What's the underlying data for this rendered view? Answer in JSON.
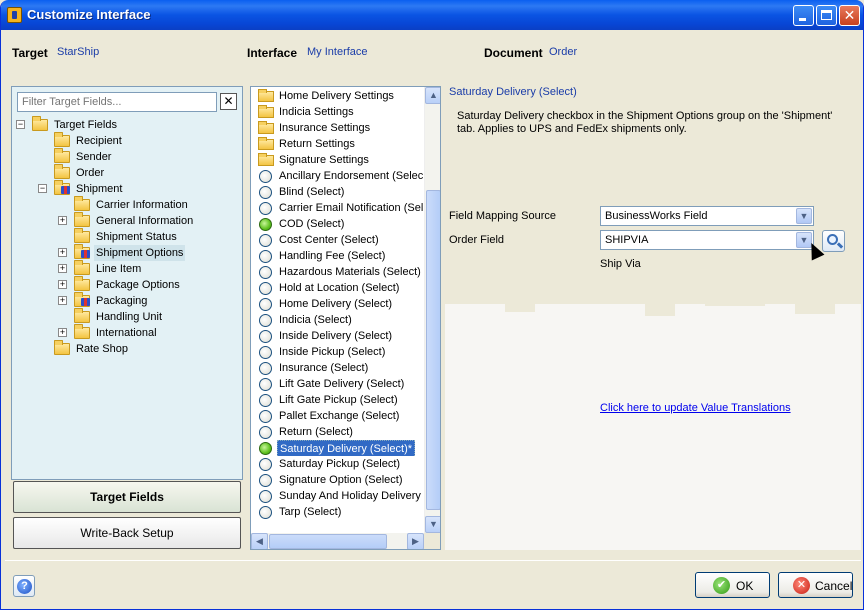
{
  "window": {
    "title": "Customize Interface"
  },
  "header": {
    "target_label": "Target",
    "target_value": "StarShip",
    "interface_label": "Interface",
    "interface_value": "My Interface",
    "document_label": "Document",
    "document_value": "Order"
  },
  "left": {
    "filter_placeholder": "Filter Target Fields...",
    "tree": [
      {
        "label": "Target Fields",
        "level": 0,
        "expander": "-",
        "icon": "folder-icon"
      },
      {
        "label": "Recipient",
        "level": 1,
        "expander": "",
        "icon": "folder-icon"
      },
      {
        "label": "Sender",
        "level": 1,
        "expander": "",
        "icon": "folder-icon"
      },
      {
        "label": "Order",
        "level": 1,
        "expander": "",
        "icon": "folder-icon"
      },
      {
        "label": "Shipment",
        "level": 1,
        "expander": "-",
        "icon": "group-folder-icon"
      },
      {
        "label": "Carrier Information",
        "level": 2,
        "expander": "",
        "icon": "folder-icon"
      },
      {
        "label": "General Information",
        "level": 2,
        "expander": "+",
        "icon": "folder-icon"
      },
      {
        "label": "Shipment Status",
        "level": 2,
        "expander": "",
        "icon": "folder-icon"
      },
      {
        "label": "Shipment Options",
        "level": 2,
        "expander": "+",
        "icon": "group-folder-icon",
        "selected": true
      },
      {
        "label": "Line Item",
        "level": 2,
        "expander": "+",
        "icon": "folder-icon"
      },
      {
        "label": "Package Options",
        "level": 2,
        "expander": "+",
        "icon": "folder-icon"
      },
      {
        "label": "Packaging",
        "level": 2,
        "expander": "+",
        "icon": "group-folder-icon"
      },
      {
        "label": "Handling Unit",
        "level": 2,
        "expander": "",
        "icon": "folder-icon"
      },
      {
        "label": "International",
        "level": 2,
        "expander": "+",
        "icon": "folder-icon"
      },
      {
        "label": "Rate Shop",
        "level": 1,
        "expander": "",
        "icon": "folder-icon"
      }
    ],
    "nav_active": "Target Fields",
    "nav_inactive": "Write-Back Setup"
  },
  "middle": {
    "items": [
      {
        "label": "Home Delivery Settings",
        "kind": "folder"
      },
      {
        "label": "Indicia Settings",
        "kind": "folder"
      },
      {
        "label": "Insurance Settings",
        "kind": "folder"
      },
      {
        "label": "Return Settings",
        "kind": "folder"
      },
      {
        "label": "Signature Settings",
        "kind": "folder"
      },
      {
        "label": "Ancillary Endorsement (Select)",
        "kind": "radio"
      },
      {
        "label": "Blind (Select)",
        "kind": "radio"
      },
      {
        "label": "Carrier Email Notification (Selec",
        "kind": "radio"
      },
      {
        "label": "COD (Select)",
        "kind": "radio-on"
      },
      {
        "label": "Cost Center (Select)",
        "kind": "radio"
      },
      {
        "label": "Handling Fee (Select)",
        "kind": "radio"
      },
      {
        "label": "Hazardous Materials (Select)",
        "kind": "radio"
      },
      {
        "label": "Hold at Location (Select)",
        "kind": "radio"
      },
      {
        "label": "Home Delivery (Select)",
        "kind": "radio"
      },
      {
        "label": "Indicia (Select)",
        "kind": "radio"
      },
      {
        "label": "Inside Delivery (Select)",
        "kind": "radio"
      },
      {
        "label": "Inside Pickup (Select)",
        "kind": "radio"
      },
      {
        "label": "Insurance (Select)",
        "kind": "radio"
      },
      {
        "label": "Lift Gate Delivery (Select)",
        "kind": "radio"
      },
      {
        "label": "Lift Gate Pickup (Select)",
        "kind": "radio"
      },
      {
        "label": "Pallet Exchange (Select)",
        "kind": "radio"
      },
      {
        "label": "Return (Select)",
        "kind": "radio"
      },
      {
        "label": "Saturday Delivery (Select)*",
        "kind": "radio-on",
        "selected": true
      },
      {
        "label": "Saturday Pickup (Select)",
        "kind": "radio"
      },
      {
        "label": "Signature Option (Select)",
        "kind": "radio"
      },
      {
        "label": "Sunday And Holiday Delivery (S",
        "kind": "radio"
      },
      {
        "label": "Tarp (Select)",
        "kind": "radio"
      }
    ]
  },
  "right": {
    "title": "Saturday Delivery (Select)",
    "description": "Saturday Delivery checkbox in the Shipment Options group on the 'Shipment' tab. Applies to UPS and FedEx shipments only.",
    "mapping_source_label": "Field Mapping Source",
    "mapping_source_value": "BusinessWorks Field",
    "order_field_label": "Order Field",
    "order_field_value": "SHIPVIA",
    "order_field_description": "Ship Via",
    "translation_link": "Click here to update Value Translations"
  },
  "footer": {
    "help_glyph": "?",
    "ok_label": "OK",
    "cancel_label": "Cancel"
  },
  "colors": {
    "title_bar": "#0a54e3",
    "tree_background": "#e3f1f5",
    "selection": "#316ac5",
    "link": "#0000ee"
  }
}
